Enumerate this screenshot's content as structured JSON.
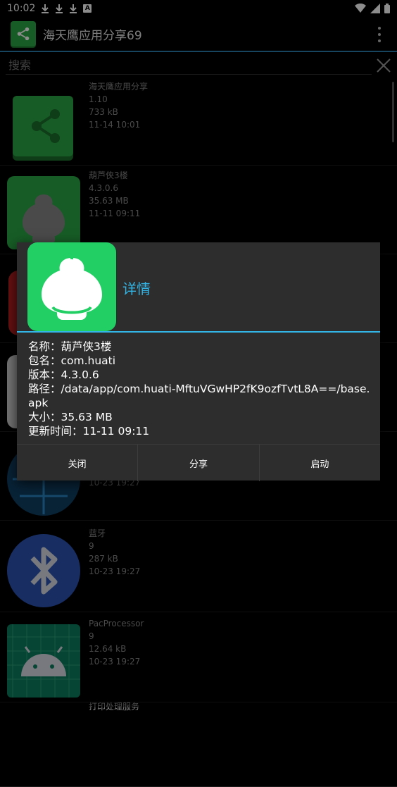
{
  "status_bar": {
    "time": "10:02",
    "badge": "A"
  },
  "app_bar": {
    "title": "海天鹰应用分享69"
  },
  "search": {
    "placeholder": "搜索"
  },
  "apps": [
    {
      "name": "海天鹰应用分享",
      "version": "1.10",
      "size": "733 kB",
      "date": "11-14 10:01"
    },
    {
      "name": "葫芦侠3楼",
      "version": "4.3.0.6",
      "size": "35.63 MB",
      "date": "11-11 09:11"
    },
    {
      "name": "",
      "version": "",
      "size": "",
      "date": ""
    },
    {
      "name": "",
      "version": "",
      "size": "",
      "date": ""
    },
    {
      "name": "",
      "version": "",
      "size": "",
      "date": "10-23 19:27"
    },
    {
      "name": "蓝牙",
      "version": "9",
      "size": "287 kB",
      "date": "10-23 19:27"
    },
    {
      "name": "PacProcessor",
      "version": "9",
      "size": "12.64 kB",
      "date": "10-23 19:27"
    },
    {
      "name": "打印处理服务",
      "version": "",
      "size": "",
      "date": ""
    }
  ],
  "dialog": {
    "title": "详情",
    "name_line": "名称：葫芦侠3楼",
    "package_line": "包名：com.huati",
    "version_line": "版本：4.3.0.6",
    "path_line": "路径：/data/app/com.huati-MftuVGwHP2fK9ozfTvtL8A==/base.apk",
    "size_line": "大小：35.63 MB",
    "updated_line": "更新时间：11-11 09:11",
    "buttons": {
      "close": "关闭",
      "share": "分享",
      "launch": "启动"
    }
  },
  "colors": {
    "accent": "#33b5e5",
    "app_green": "#2aa845",
    "huluxia_green": "#21cf64"
  },
  "icons": {
    "app_bar": "share-icon",
    "search_clear": "close-icon",
    "dialog": "huluxia-mascot-icon"
  }
}
